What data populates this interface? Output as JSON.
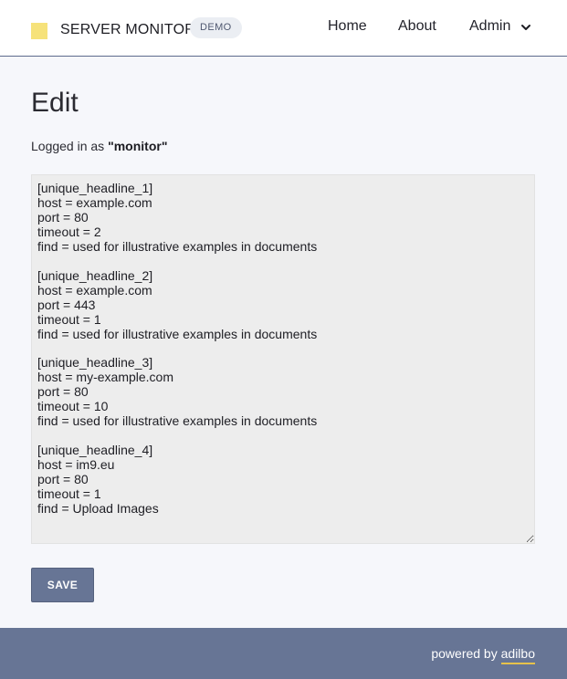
{
  "header": {
    "brand": "SERVER MONITOR",
    "badge": "DEMO",
    "nav": {
      "home": "Home",
      "about": "About",
      "admin": "Admin"
    }
  },
  "main": {
    "title": "Edit",
    "login_prefix": "Logged in as ",
    "login_user": "\"monitor\"",
    "config_text": "[unique_headline_1]\nhost = example.com\nport = 80\ntimeout = 2\nfind = used for illustrative examples in documents\n\n[unique_headline_2]\nhost = example.com\nport = 443\ntimeout = 1\nfind = used for illustrative examples in documents\n\n[unique_headline_3]\nhost = my-example.com\nport = 80\ntimeout = 10\nfind = used for illustrative examples in documents\n\n[unique_headline_4]\nhost = im9.eu\nport = 80\ntimeout = 1\nfind = Upload Images",
    "save_label": "SAVE"
  },
  "footer": {
    "powered_prefix": "powered by ",
    "powered_brand": "adilbo"
  },
  "colors": {
    "accent": "#677595",
    "logo": "#f6e27a",
    "underline": "#e6c24b"
  }
}
